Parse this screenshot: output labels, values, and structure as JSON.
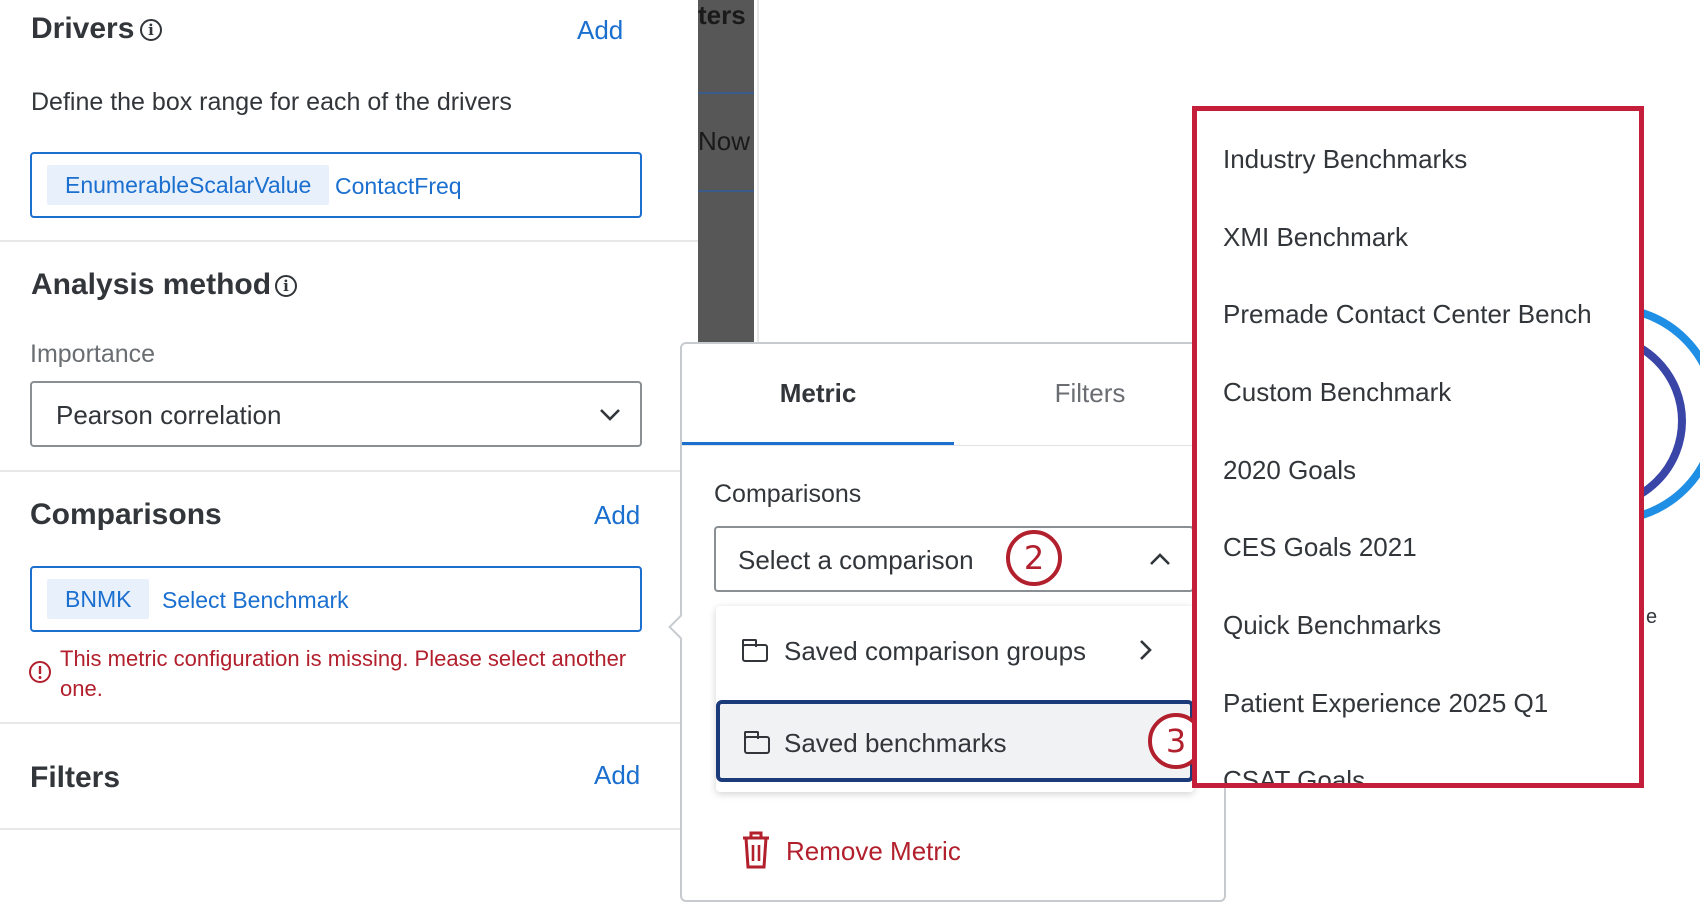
{
  "background_panel": {
    "title_fragment": "ters",
    "row_fragment": "Now I",
    "right_fragment": "e"
  },
  "drivers": {
    "title": "Drivers",
    "add_label": "Add",
    "description": "Define the box range for each of the drivers",
    "chip": "EnumerableScalarValue",
    "value": "ContactFreq"
  },
  "analysis": {
    "title": "Analysis method",
    "field_label": "Importance",
    "selected": "Pearson correlation"
  },
  "comparisons": {
    "title": "Comparisons",
    "add_label": "Add",
    "chip": "BNMK",
    "value": "Select Benchmark",
    "error": "This metric configuration is missing. Please select another one."
  },
  "filters": {
    "title": "Filters",
    "add_label": "Add"
  },
  "popover": {
    "tabs": [
      {
        "label": "Metric",
        "active": true
      },
      {
        "label": "Filters",
        "active": false
      }
    ],
    "field_label": "Comparisons",
    "select_placeholder": "Select a comparison",
    "menu_items": [
      {
        "label": "Saved comparison groups",
        "has_submenu": true,
        "highlighted": false
      },
      {
        "label": "Saved benchmarks",
        "has_submenu": false,
        "highlighted": true
      }
    ],
    "remove_label": "Remove Metric"
  },
  "steps": {
    "two": "2",
    "three": "3"
  },
  "benchmarks": [
    "Industry Benchmarks",
    "XMI Benchmark",
    "Premade Contact Center Bench",
    "Custom Benchmark",
    "2020 Goals",
    "CES Goals 2021",
    "Quick Benchmarks",
    "Patient Experience 2025 Q1",
    "CSAT Goals"
  ],
  "colors": {
    "link": "#1a6fcf",
    "error": "#b21f2d",
    "highlight_border": "#c41e3a",
    "tab_active": "#1a6fcf"
  }
}
